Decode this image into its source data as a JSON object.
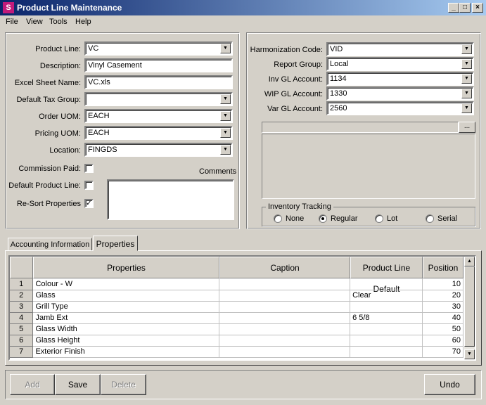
{
  "window": {
    "title": "Product Line Maintenance",
    "icon": "app-logo-icon"
  },
  "menu": [
    "File",
    "View",
    "Tools",
    "Help"
  ],
  "left": {
    "product_line": {
      "label": "Product Line:",
      "value": "VC"
    },
    "description": {
      "label": "Description:",
      "value": "Vinyl Casement"
    },
    "excel_sheet": {
      "label": "Excel Sheet Name:",
      "value": "VC.xls"
    },
    "default_tax": {
      "label": "Default Tax Group:",
      "value": ""
    },
    "order_uom": {
      "label": "Order UOM:",
      "value": "EACH"
    },
    "pricing_uom": {
      "label": "Pricing UOM:",
      "value": "EACH"
    },
    "location": {
      "label": "Location:",
      "value": "FINGDS"
    },
    "commission_paid": {
      "label": "Commission Paid:",
      "checked": false
    },
    "default_product_line": {
      "label": "Default Product Line:",
      "checked": false
    },
    "resort_properties": {
      "label": "Re-Sort Properties",
      "checked": true
    },
    "comments_label": "Comments",
    "comments_value": ""
  },
  "right": {
    "harmonization": {
      "label": "Harmonization Code:",
      "value": "VID"
    },
    "report_group": {
      "label": "Report Group:",
      "value": "Local"
    },
    "inv_gl": {
      "label": "Inv GL Account:",
      "value": "1134"
    },
    "wip_gl": {
      "label": "WIP GL Account:",
      "value": "1330"
    },
    "var_gl": {
      "label": "Var GL Account:",
      "value": "2560"
    },
    "browse_label": "...",
    "inventory_tracking": {
      "title": "Inventory Tracking",
      "options": [
        "None",
        "Regular",
        "Lot",
        "Serial"
      ],
      "selected": "Regular"
    }
  },
  "tabs": [
    "Accounting Information",
    "Properties"
  ],
  "active_tab": "Properties",
  "grid": {
    "headers": [
      "Properties",
      "Caption",
      "Product Line Default",
      "Position"
    ],
    "rows": [
      {
        "n": "1",
        "prop": "Colour - W",
        "caption": "",
        "default": "",
        "pos": "10"
      },
      {
        "n": "2",
        "prop": "Glass",
        "caption": "",
        "default": "Clear",
        "pos": "20"
      },
      {
        "n": "3",
        "prop": "Grill Type",
        "caption": "",
        "default": "",
        "pos": "30"
      },
      {
        "n": "4",
        "prop": "Jamb Ext",
        "caption": "",
        "default": "6 5/8",
        "pos": "40"
      },
      {
        "n": "5",
        "prop": "Glass Width",
        "caption": "",
        "default": "",
        "pos": "50"
      },
      {
        "n": "6",
        "prop": "Glass Height",
        "caption": "",
        "default": "",
        "pos": "60"
      },
      {
        "n": "7",
        "prop": "Exterior Finish",
        "caption": "",
        "default": "",
        "pos": "70"
      }
    ]
  },
  "buttons": {
    "add": "Add",
    "save": "Save",
    "delete": "Delete",
    "undo": "Undo"
  },
  "window_buttons": {
    "minimize": "_",
    "maximize": "□",
    "close": "×"
  }
}
